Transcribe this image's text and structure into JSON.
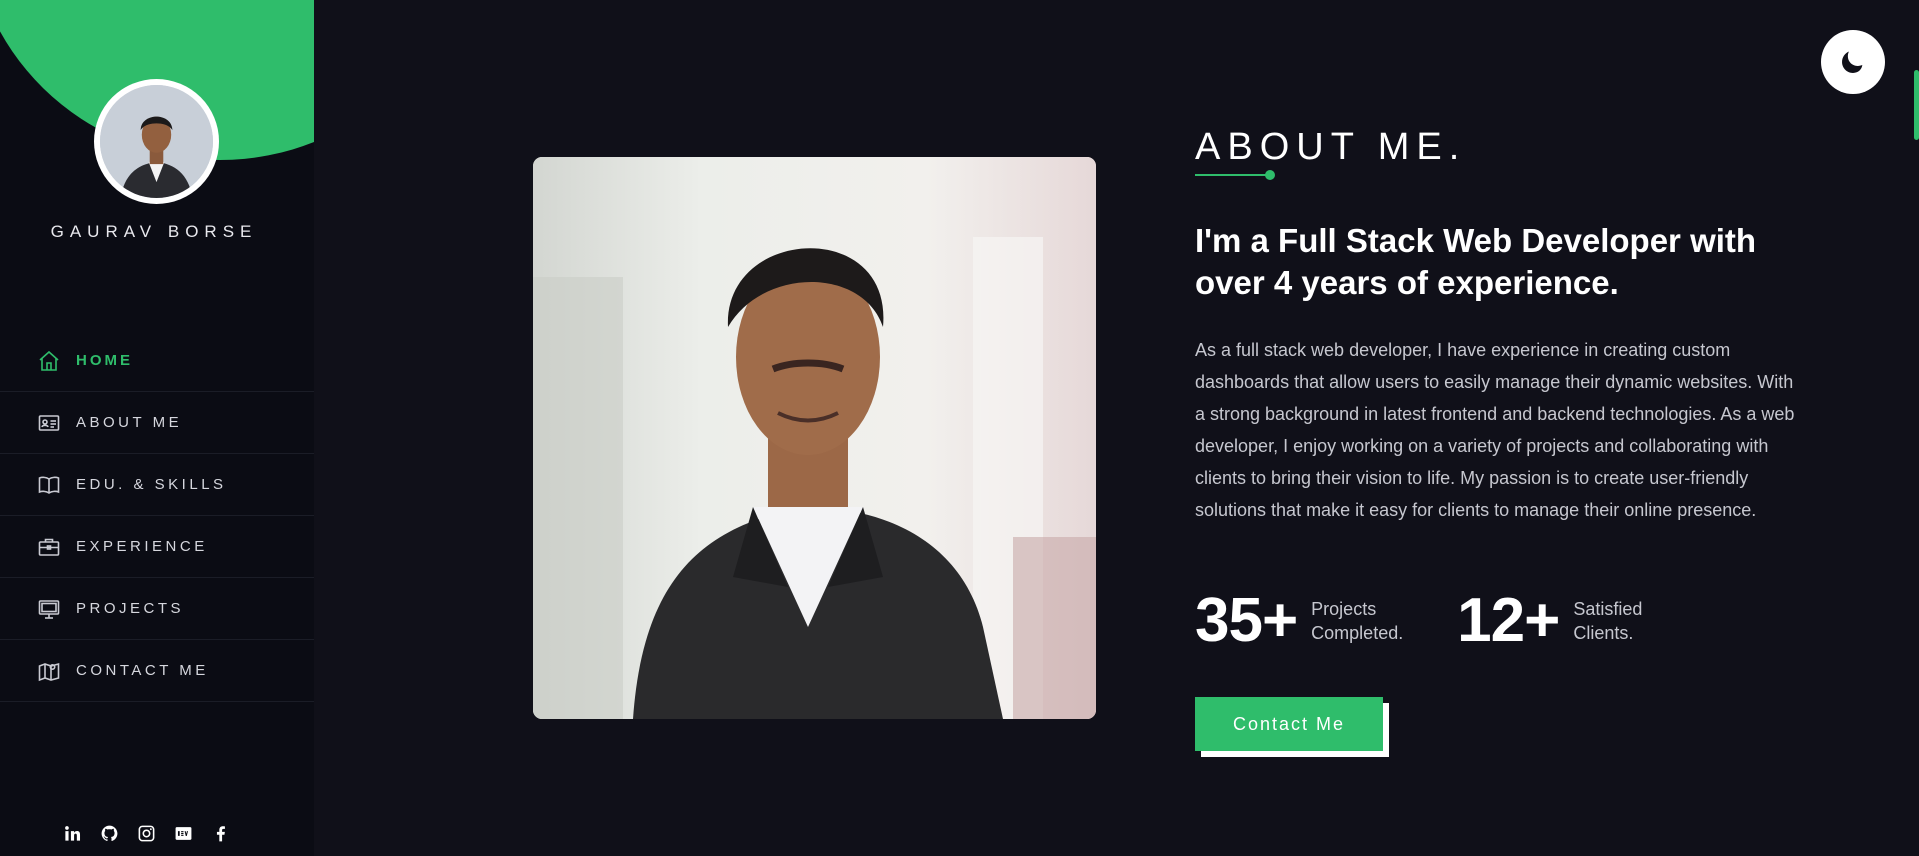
{
  "colors": {
    "accent": "#2fbd6b",
    "background": "#101019",
    "sidebar": "#0b0c14",
    "text": "#ffffff"
  },
  "sidebar": {
    "name": "GAURAV BORSE",
    "nav": [
      {
        "label": "HOME",
        "icon": "home-icon",
        "active": true
      },
      {
        "label": "ABOUT ME",
        "icon": "id-card-icon",
        "active": false
      },
      {
        "label": "EDU. & SKILLS",
        "icon": "book-icon",
        "active": false
      },
      {
        "label": "EXPERIENCE",
        "icon": "briefcase-icon",
        "active": false
      },
      {
        "label": "PROJECTS",
        "icon": "monitor-icon",
        "active": false
      },
      {
        "label": "CONTACT ME",
        "icon": "map-pin-icon",
        "active": false
      }
    ],
    "socials": [
      "linkedin-icon",
      "github-icon",
      "instagram-icon",
      "dev-icon",
      "facebook-icon"
    ]
  },
  "about": {
    "title": "ABOUT ME.",
    "headline": "I'm a Full Stack Web Developer with over 4 years of experience.",
    "bio": "As a full stack web developer, I have experience in creating custom dashboards that allow users to easily manage their dynamic websites. With a strong background in latest frontend and backend technologies. As a web developer, I enjoy working on a variety of projects and collaborating with clients to bring their vision to life. My passion is to create user-friendly solutions that make it easy for clients to manage their online presence.",
    "stats": [
      {
        "value": "35+",
        "label": "Projects Completed."
      },
      {
        "value": "12+",
        "label": "Satisfied Clients."
      }
    ],
    "cta_label": "Contact Me"
  },
  "theme_toggle_icon": "moon-icon"
}
